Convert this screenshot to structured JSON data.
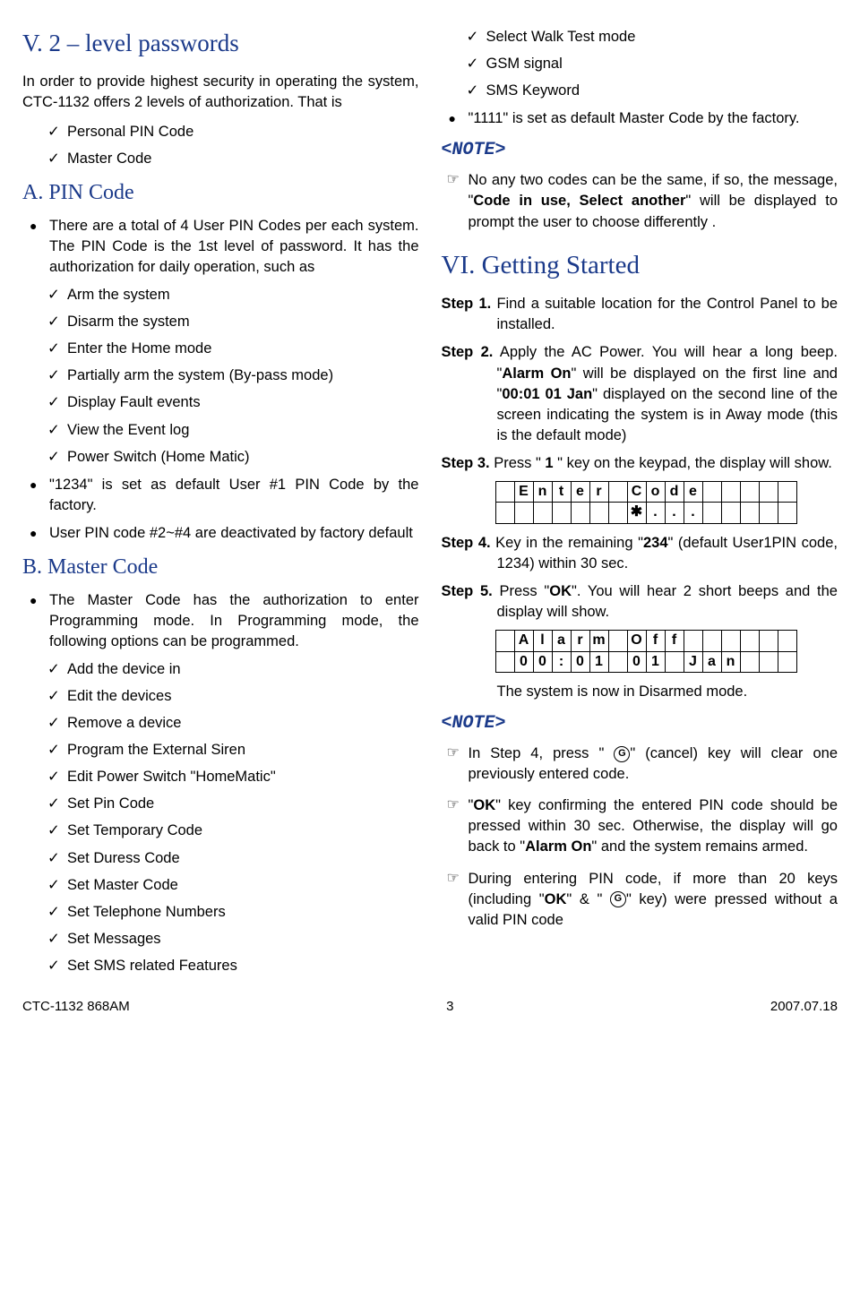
{
  "left": {
    "h_v": "V. 2 – level passwords",
    "intro": "In order to provide highest security in operating the system, CTC-1132 offers 2 levels of authorization. That is",
    "intro_list": [
      "Personal PIN Code",
      "Master Code"
    ],
    "h_a": "A. PIN Code",
    "a_para": "There are a total of 4 User PIN Codes per each system.  The PIN Code is the 1st level of password.  It has the authorization for daily operation, such as",
    "a_list": [
      "Arm the system",
      "Disarm the system",
      "Enter the Home mode",
      "Partially arm the system (By-pass mode)",
      "Display Fault events",
      "View the Event log",
      "Power Switch (Home Matic)"
    ],
    "a_bullets": [
      "\"1234\" is set as default User #1 PIN Code by the factory.",
      "User PIN code #2~#4 are deactivated by factory default"
    ],
    "h_b": "B. Master Code",
    "b_para": "The Master Code has the authorization to enter Programming mode.  In Programming mode, the following options can be programmed.",
    "b_list": [
      "Add the device in",
      "Edit the devices",
      "Remove a device",
      "Program the External Siren",
      "Edit Power Switch \"HomeMatic\"",
      "Set Pin Code",
      "Set Temporary Code",
      "Set Duress Code",
      "Set Master Code",
      "Set Telephone Numbers",
      "Set Messages",
      "Set SMS related Features"
    ]
  },
  "right": {
    "top_checks": [
      "Select Walk Test mode",
      "GSM signal",
      "SMS Keyword"
    ],
    "top_bullet": "\"1111\" is set as default Master Code by the factory.",
    "note_label": "<NOTE>",
    "note1_pre": "No any two codes can be the same, if so, the message, \"",
    "note1_bold": "Code in use, Select another",
    "note1_post": "\" will be displayed to prompt the user to choose differently .",
    "h_vi": "VI. Getting Started",
    "step1_label": "Step 1.",
    "step1_text": " Find a suitable location for the Control Panel to be installed.",
    "step2_label": "Step 2.",
    "step2_a": " Apply the AC Power.  You will hear a long beep.  \"",
    "step2_b1": "Alarm On",
    "step2_c": "\" will be displayed on the first line and \"",
    "step2_b2": "00:01 01 Jan",
    "step2_d": "\" displayed on the second line of the screen indicating the system is in Away mode (this is the default mode)",
    "step3_label": "Step 3.",
    "step3_a": " Press \" ",
    "step3_b": "1",
    "step3_c": " \" key on the keypad, the display will show.",
    "lcd1_r1": [
      "",
      "E",
      "n",
      "t",
      "e",
      "r",
      "",
      "C",
      "o",
      "d",
      "e",
      "",
      "",
      "",
      "",
      ""
    ],
    "lcd1_r2": [
      "",
      "",
      "",
      "",
      "",
      "",
      "",
      "✱",
      ".",
      ".",
      ".",
      "",
      "",
      "",
      "",
      ""
    ],
    "step4_label": "Step 4.",
    "step4_a": " Key in the remaining \"",
    "step4_b": "234",
    "step4_c": "\" (default User1PIN code, 1234) within 30 sec.",
    "step5_label": "Step 5.",
    "step5_a": " Press \"",
    "step5_b": "OK",
    "step5_c": "\".  You will hear 2 short beeps and the display will show.",
    "lcd2_r1": [
      "",
      "A",
      "l",
      "a",
      "r",
      "m",
      "",
      "O",
      "f",
      "f",
      "",
      "",
      "",
      "",
      "",
      ""
    ],
    "lcd2_r2": [
      "",
      "0",
      "0",
      ":",
      "0",
      "1",
      "",
      "0",
      "1",
      "",
      "J",
      "a",
      "n",
      "",
      "",
      ""
    ],
    "disarmed": "The system is now in Disarmed mode.",
    "hand1_a": "In Step 4, press \"  ",
    "hand1_b": "\" (cancel) key will clear one previously entered code.",
    "hand2_a": "\"",
    "hand2_b1": "OK",
    "hand2_c": "\" key confirming the entered PIN code should be pressed within 30 sec. Otherwise, the display will go back to \"",
    "hand2_b2": "Alarm On",
    "hand2_d": "\" and the system remains armed.",
    "hand3_a": "During entering PIN code, if more than 20 keys (including \"",
    "hand3_b": "OK",
    "hand3_c": "\" & \"  ",
    "hand3_d": "\" key) were pressed without a valid PIN code"
  },
  "footer": {
    "left": "CTC-1132 868AM",
    "center": "3",
    "right": "2007.07.18"
  }
}
